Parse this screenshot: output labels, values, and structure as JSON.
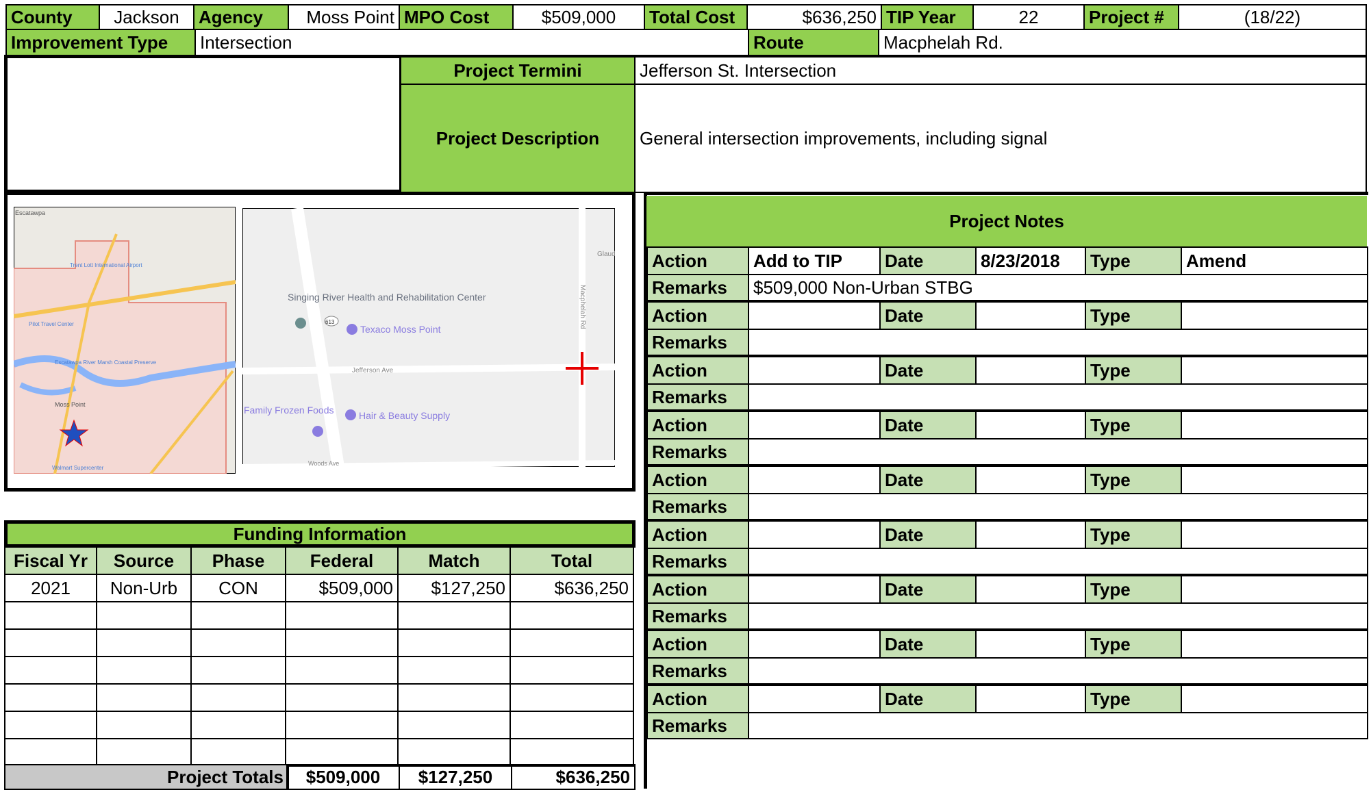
{
  "header": {
    "county_label": "County",
    "county": "Jackson",
    "agency_label": "Agency",
    "agency": "Moss Point",
    "mpo_cost_label": "MPO Cost",
    "mpo_cost": "$509,000",
    "total_cost_label": "Total Cost",
    "total_cost": "$636,250",
    "tip_year_label": "TIP Year",
    "tip_year": "22",
    "project_num_label": "Project #",
    "project_num": "(18/22)",
    "improvement_type_label": "Improvement Type",
    "improvement_type": "Intersection",
    "route_label": "Route",
    "route": "Macphelah Rd."
  },
  "project": {
    "termini_label": "Project Termini",
    "termini": "Jefferson St. Intersection",
    "description_label": "Project Description",
    "description": "General intersection improvements, including signal"
  },
  "maps": {
    "regional": {
      "labels": [
        "Escatawpa",
        "Trent Lott International Airport",
        "Pilot Travel Center",
        "Escatawpa River Marsh Coastal Preserve",
        "Moss Point",
        "Walmart Supercenter"
      ]
    },
    "detail": {
      "labels": [
        "Singing River Health and Rehabilitation Center",
        "Texaco Moss Point",
        "Jefferson Ave",
        "Macphelah Rd",
        "Family Frozen Foods",
        "Hair & Beauty Supply",
        "Woods Ave",
        "Glaud",
        "613"
      ]
    }
  },
  "funding": {
    "title": "Funding Information",
    "headers": [
      "Fiscal Yr",
      "Source",
      "Phase",
      "Federal",
      "Match",
      "Total"
    ],
    "rows": [
      [
        "2021",
        "Non-Urb",
        "CON",
        "$509,000",
        "$127,250",
        "$636,250"
      ],
      [
        "",
        "",
        "",
        "",
        "",
        ""
      ],
      [
        "",
        "",
        "",
        "",
        "",
        ""
      ],
      [
        "",
        "",
        "",
        "",
        "",
        ""
      ],
      [
        "",
        "",
        "",
        "",
        "",
        ""
      ],
      [
        "",
        "",
        "",
        "",
        "",
        ""
      ],
      [
        "",
        "",
        "",
        "",
        "",
        ""
      ]
    ],
    "totals_label": "Project Totals",
    "totals": [
      "$509,000",
      "$127,250",
      "$636,250"
    ]
  },
  "notes": {
    "title": "Project Notes",
    "action_label": "Action",
    "date_label": "Date",
    "type_label": "Type",
    "remarks_label": "Remarks",
    "entries": [
      {
        "action": "Add to TIP",
        "date": "8/23/2018",
        "type": "Amend",
        "remarks": "$509,000 Non-Urban STBG"
      },
      {
        "action": "",
        "date": "",
        "type": "",
        "remarks": ""
      },
      {
        "action": "",
        "date": "",
        "type": "",
        "remarks": ""
      },
      {
        "action": "",
        "date": "",
        "type": "",
        "remarks": ""
      },
      {
        "action": "",
        "date": "",
        "type": "",
        "remarks": ""
      },
      {
        "action": "",
        "date": "",
        "type": "",
        "remarks": ""
      },
      {
        "action": "",
        "date": "",
        "type": "",
        "remarks": ""
      },
      {
        "action": "",
        "date": "",
        "type": "",
        "remarks": ""
      },
      {
        "action": "",
        "date": "",
        "type": "",
        "remarks": ""
      }
    ]
  },
  "colors": {
    "header_green": "#92d050",
    "light_green": "#c6e0b4",
    "totals_gray": "#c8c8c8",
    "marker_red": "#e60000",
    "marker_blue": "#1f4fbf"
  }
}
